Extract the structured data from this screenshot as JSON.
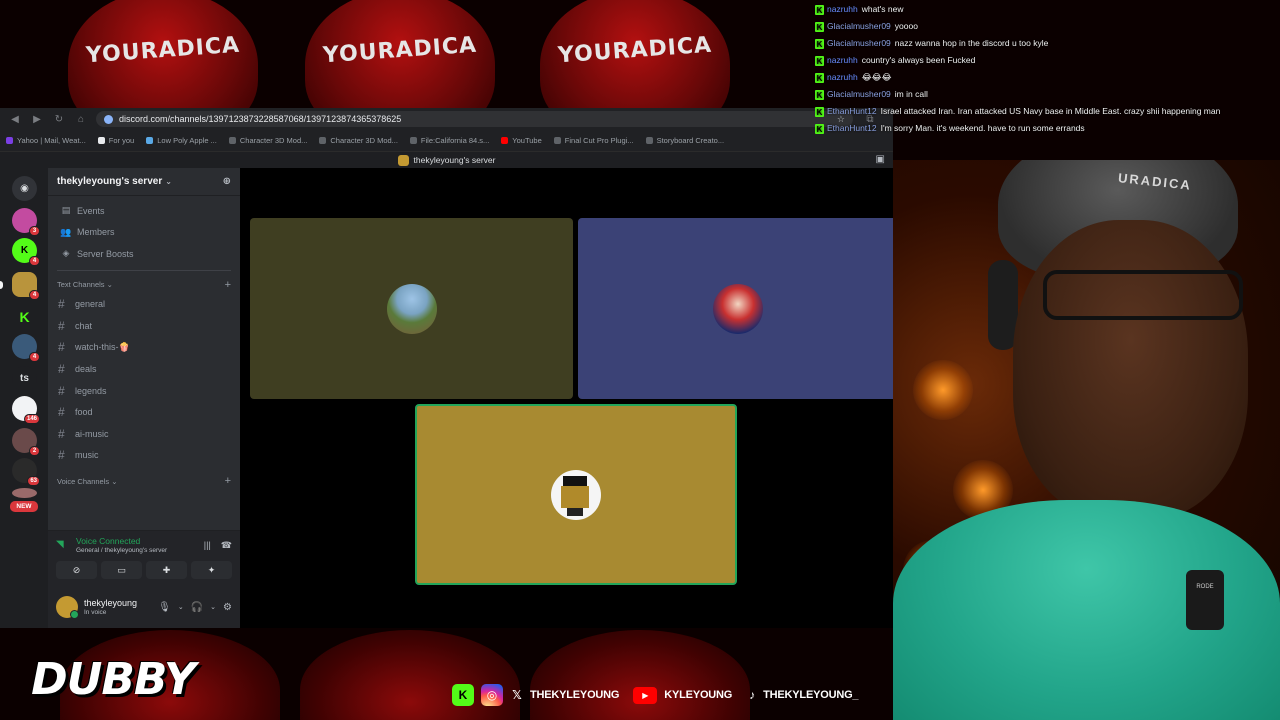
{
  "background": {
    "hat_text": "YOURADICA"
  },
  "browser": {
    "url": "discord.com/channels/1397123873228587068/1397123874365378625",
    "bookmarks": [
      {
        "label": "Yahoo | Mail, Weat..."
      },
      {
        "label": "For you"
      },
      {
        "label": "Low Poly Apple ..."
      },
      {
        "label": "Character 3D Mod..."
      },
      {
        "label": "Character 3D Mod..."
      },
      {
        "label": "File:California 84.s..."
      },
      {
        "label": "YouTube"
      },
      {
        "label": "Final Cut Pro Plugi..."
      },
      {
        "label": "Storyboard Creato..."
      }
    ]
  },
  "discord": {
    "window_title": "thekyleyoung's server",
    "server_name": "thekyleyoung's server",
    "guild_badges": [
      "3",
      "4",
      "4",
      "4",
      "146",
      "2",
      "63"
    ],
    "guild_text_ts": "ts",
    "new_label": "NEW",
    "menu": [
      {
        "label": "Events",
        "icon": "calendar-icon"
      },
      {
        "label": "Members",
        "icon": "members-icon"
      },
      {
        "label": "Server Boosts",
        "icon": "boost-icon"
      }
    ],
    "text_channels_label": "Text Channels",
    "text_channels": [
      "general",
      "chat",
      "watch-this-🍿",
      "deals",
      "legends",
      "food",
      "ai-music",
      "music"
    ],
    "voice_channels_label": "Voice Channels",
    "voice_panel": {
      "status": "Voice Connected",
      "location": "General / thekyleyoung's server"
    },
    "user": {
      "name": "thekyleyoung",
      "status": "In voice"
    },
    "tiles": [
      {
        "color": "#3f3e21",
        "avatar": "landscape-avatar"
      },
      {
        "color": "#3b4276",
        "avatar": "anime-avatar"
      },
      {
        "color": "#a88a31",
        "avatar": "pixel-avatar"
      }
    ],
    "colors": {
      "green": "#23a55a",
      "blurple": "#5865f2"
    }
  },
  "chat": [
    {
      "user": "nazruhh",
      "message": "what's new"
    },
    {
      "user": "Glacialmusher09",
      "message": "yoooo"
    },
    {
      "user": "Glacialmusher09",
      "message": "nazz wanna hop in the discord u too kyle"
    },
    {
      "user": "nazruhh",
      "message": "country's always been Fucked"
    },
    {
      "user": "nazruhh",
      "message": "😂😂😂"
    },
    {
      "user": "Glacialmusher09",
      "message": "im in call"
    },
    {
      "user": "EthanHunt12",
      "message": "Israel attacked Iran. Iran attacked US Navy base in Middle East. crazy shii happening man"
    },
    {
      "user": "EthanHunt12",
      "message": "I'm sorry Man. it's weekend. have to run some errands"
    }
  ],
  "webcam": {
    "cap_text": "URADICA",
    "mic_label": "RODE"
  },
  "overlay": {
    "brand": "DUBBY",
    "socials": [
      {
        "icon": "kick-icon",
        "label": ""
      },
      {
        "icon": "instagram-icon",
        "label": ""
      },
      {
        "icon": "x-icon",
        "label": "THEKYLEYOUNG"
      },
      {
        "icon": "youtube-icon",
        "label": "KYLEYOUNG"
      },
      {
        "icon": "tiktok-icon",
        "label": "THEKYLEYOUNG_"
      }
    ]
  }
}
